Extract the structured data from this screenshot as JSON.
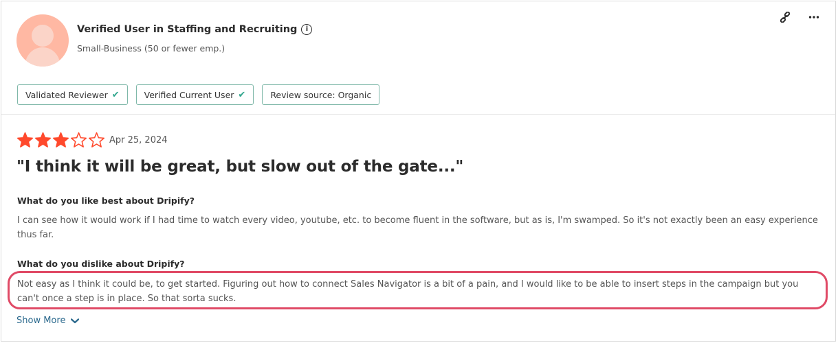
{
  "reviewer": {
    "name": "Verified User in Staffing and Recruiting",
    "company_size": "Small-Business (50 or fewer emp.)"
  },
  "icons": {
    "info": "info-icon",
    "link": "link-icon",
    "more": "more-icon",
    "check": "check-icon",
    "star": "star-icon",
    "chevron": "chevron-down-icon"
  },
  "badges": [
    {
      "label": "Validated Reviewer",
      "check": true
    },
    {
      "label": "Verified Current User",
      "check": true
    },
    {
      "label": "Review source: Organic",
      "check": false
    }
  ],
  "rating": {
    "value": 3,
    "max": 5
  },
  "review": {
    "date": "Apr 25, 2024",
    "title": "\"I think it will be great, but slow out of the gate...\"",
    "likes_question": "What do you like best about Dripify?",
    "likes_answer": "I can see how it would work if I had time to watch every video, youtube, etc. to become fluent in the software, but as is, I'm swamped. So it's not exactly been an easy experience thus far.",
    "dislikes_question": "What do you dislike about Dripify?",
    "dislikes_answer": "Not easy as I think it could be, to get started. Figuring out how to connect Sales Navigator is a bit of a pain, and I would like to be able to insert steps in the campaign but you can't once a step is in place. So that sorta sucks.",
    "show_more": "Show More"
  },
  "colors": {
    "star_filled": "#ff492c",
    "badge_border": "#7fb8a9",
    "check": "#2ea58c",
    "highlight": "#e04a66",
    "link": "#2c6a8e"
  }
}
